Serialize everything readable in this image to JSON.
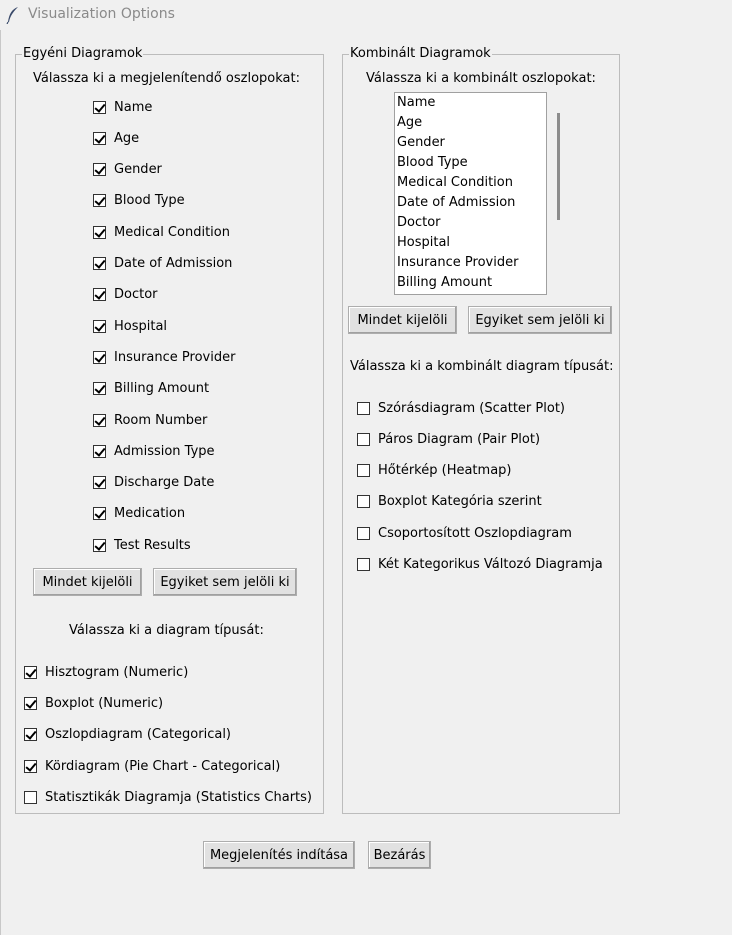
{
  "window": {
    "title": "Visualization Options",
    "icon": "feather-icon"
  },
  "individual": {
    "group_title": "Egyéni Diagramok",
    "prompt": "Válassza ki a megjelenítendő oszlopokat:",
    "columns": [
      {
        "label": "Name",
        "checked": true
      },
      {
        "label": "Age",
        "checked": true
      },
      {
        "label": "Gender",
        "checked": true
      },
      {
        "label": "Blood Type",
        "checked": true
      },
      {
        "label": "Medical Condition",
        "checked": true
      },
      {
        "label": "Date of Admission",
        "checked": true
      },
      {
        "label": "Doctor",
        "checked": true
      },
      {
        "label": "Hospital",
        "checked": true
      },
      {
        "label": "Insurance Provider",
        "checked": true
      },
      {
        "label": "Billing Amount",
        "checked": true
      },
      {
        "label": "Room Number",
        "checked": true
      },
      {
        "label": "Admission Type",
        "checked": true
      },
      {
        "label": "Discharge Date",
        "checked": true
      },
      {
        "label": "Medication",
        "checked": true
      },
      {
        "label": "Test Results",
        "checked": true
      }
    ],
    "select_all_label": "Mindet kijelöli",
    "select_none_label": "Egyiket sem jelöli ki",
    "type_prompt": "Válassza ki a diagram típusát:",
    "chart_types": [
      {
        "label": "Hisztogram (Numeric)",
        "checked": true
      },
      {
        "label": "Boxplot (Numeric)",
        "checked": true
      },
      {
        "label": "Oszlopdiagram (Categorical)",
        "checked": true
      },
      {
        "label": "Kördiagram (Pie Chart - Categorical)",
        "checked": true
      },
      {
        "label": "Statisztikák Diagramja (Statistics Charts)",
        "checked": false
      }
    ]
  },
  "combined": {
    "group_title": "Kombinált Diagramok",
    "prompt": "Válassza ki a kombinált oszlopokat:",
    "list_items": [
      "Name",
      "Age",
      "Gender",
      "Blood Type",
      "Medical Condition",
      "Date of Admission",
      "Doctor",
      "Hospital",
      "Insurance Provider",
      "Billing Amount"
    ],
    "select_all_label": "Mindet kijelöli",
    "select_none_label": "Egyiket sem jelöli ki",
    "type_prompt": "Válassza ki a kombinált diagram típusát:",
    "chart_types": [
      {
        "label": "Szórásdiagram (Scatter Plot)",
        "checked": false
      },
      {
        "label": "Páros Diagram (Pair Plot)",
        "checked": false
      },
      {
        "label": "Hőtérkép (Heatmap)",
        "checked": false
      },
      {
        "label": "Boxplot Kategória szerint",
        "checked": false
      },
      {
        "label": "Csoportosított Oszlopdiagram",
        "checked": false
      },
      {
        "label": "Két Kategorikus Változó Diagramja",
        "checked": false
      }
    ]
  },
  "footer": {
    "start_label": "Megjelenítés indítása",
    "close_label": "Bezárás"
  }
}
